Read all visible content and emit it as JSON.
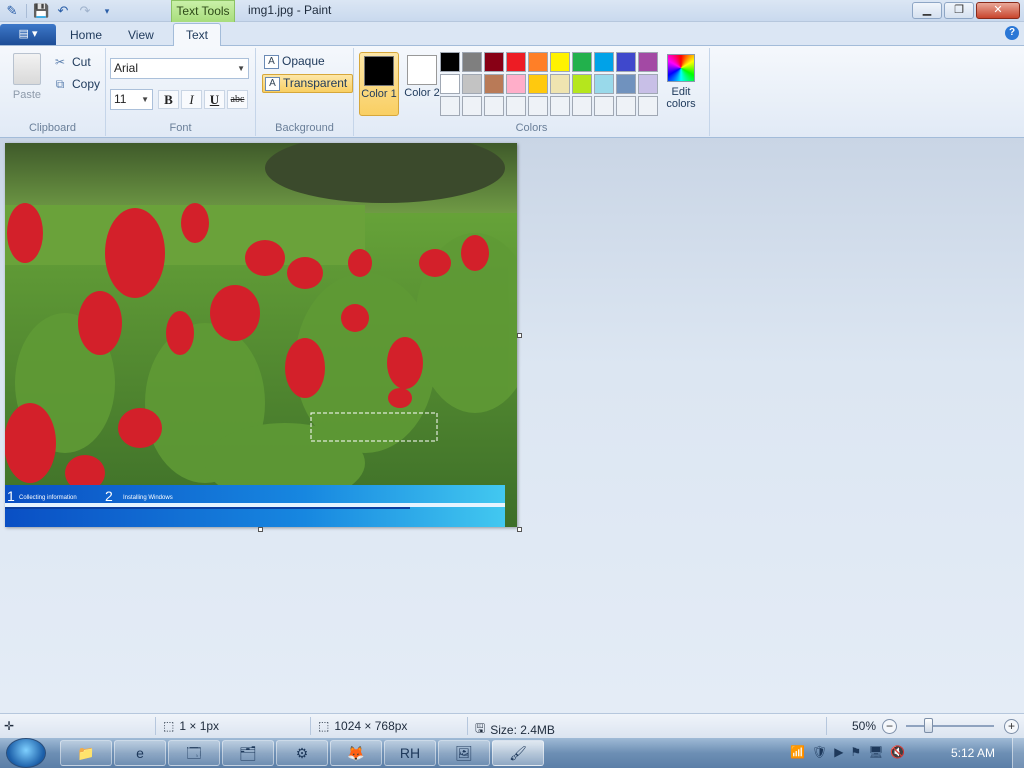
{
  "window": {
    "title": "img1.jpg - Paint",
    "context_tab": "Text Tools",
    "minimize_label": "▁",
    "maximize_label": "❐",
    "close_label": "✕"
  },
  "tabs": {
    "app_menu": "▤ ▾",
    "home": "Home",
    "view": "View",
    "text": "Text",
    "help": "?"
  },
  "ribbon": {
    "clipboard": {
      "label": "Clipboard",
      "paste": "Paste",
      "cut": "Cut",
      "copy": "Copy"
    },
    "font": {
      "label": "Font",
      "family": "Arial",
      "size": "11",
      "bold": "B",
      "italic": "I",
      "underline": "U",
      "strike": "abc"
    },
    "background": {
      "label": "Background",
      "opaque": "Opaque",
      "transparent": "Transparent"
    },
    "colors": {
      "label": "Colors",
      "color1": "Color 1",
      "color2": "Color 2",
      "color1_value": "#000000",
      "color2_value": "#ffffff",
      "edit": "Edit colors",
      "palette": [
        "#000000",
        "#7f7f7f",
        "#880015",
        "#ed1c24",
        "#ff7f27",
        "#fff200",
        "#22b14c",
        "#00a2e8",
        "#3f48cc",
        "#a349a4",
        "#ffffff",
        "#c3c3c3",
        "#b97a57",
        "#ffaec9",
        "#ffc90e",
        "#efe4b0",
        "#b5e61d",
        "#99d9ea",
        "#7092be",
        "#c8bfe7",
        "#eef2f7",
        "#eef2f7",
        "#eef2f7",
        "#eef2f7",
        "#eef2f7",
        "#eef2f7",
        "#eef2f7",
        "#eef2f7",
        "#eef2f7",
        "#eef2f7"
      ]
    }
  },
  "canvas": {
    "banner": {
      "step1_num": "1",
      "step1": "Collecting information",
      "step2_num": "2",
      "step2": "Installing Windows"
    }
  },
  "status": {
    "selection": "1 × 1px",
    "image_size": "1024 × 768px",
    "file_size": "Size: 2.4MB",
    "zoom": "50%"
  },
  "taskbar": {
    "clock": "5:12 AM",
    "buttons": [
      "📁",
      "e",
      "🗔",
      "🗂",
      "⚙",
      "🦊",
      "RH",
      "🖼",
      "🖌"
    ]
  }
}
